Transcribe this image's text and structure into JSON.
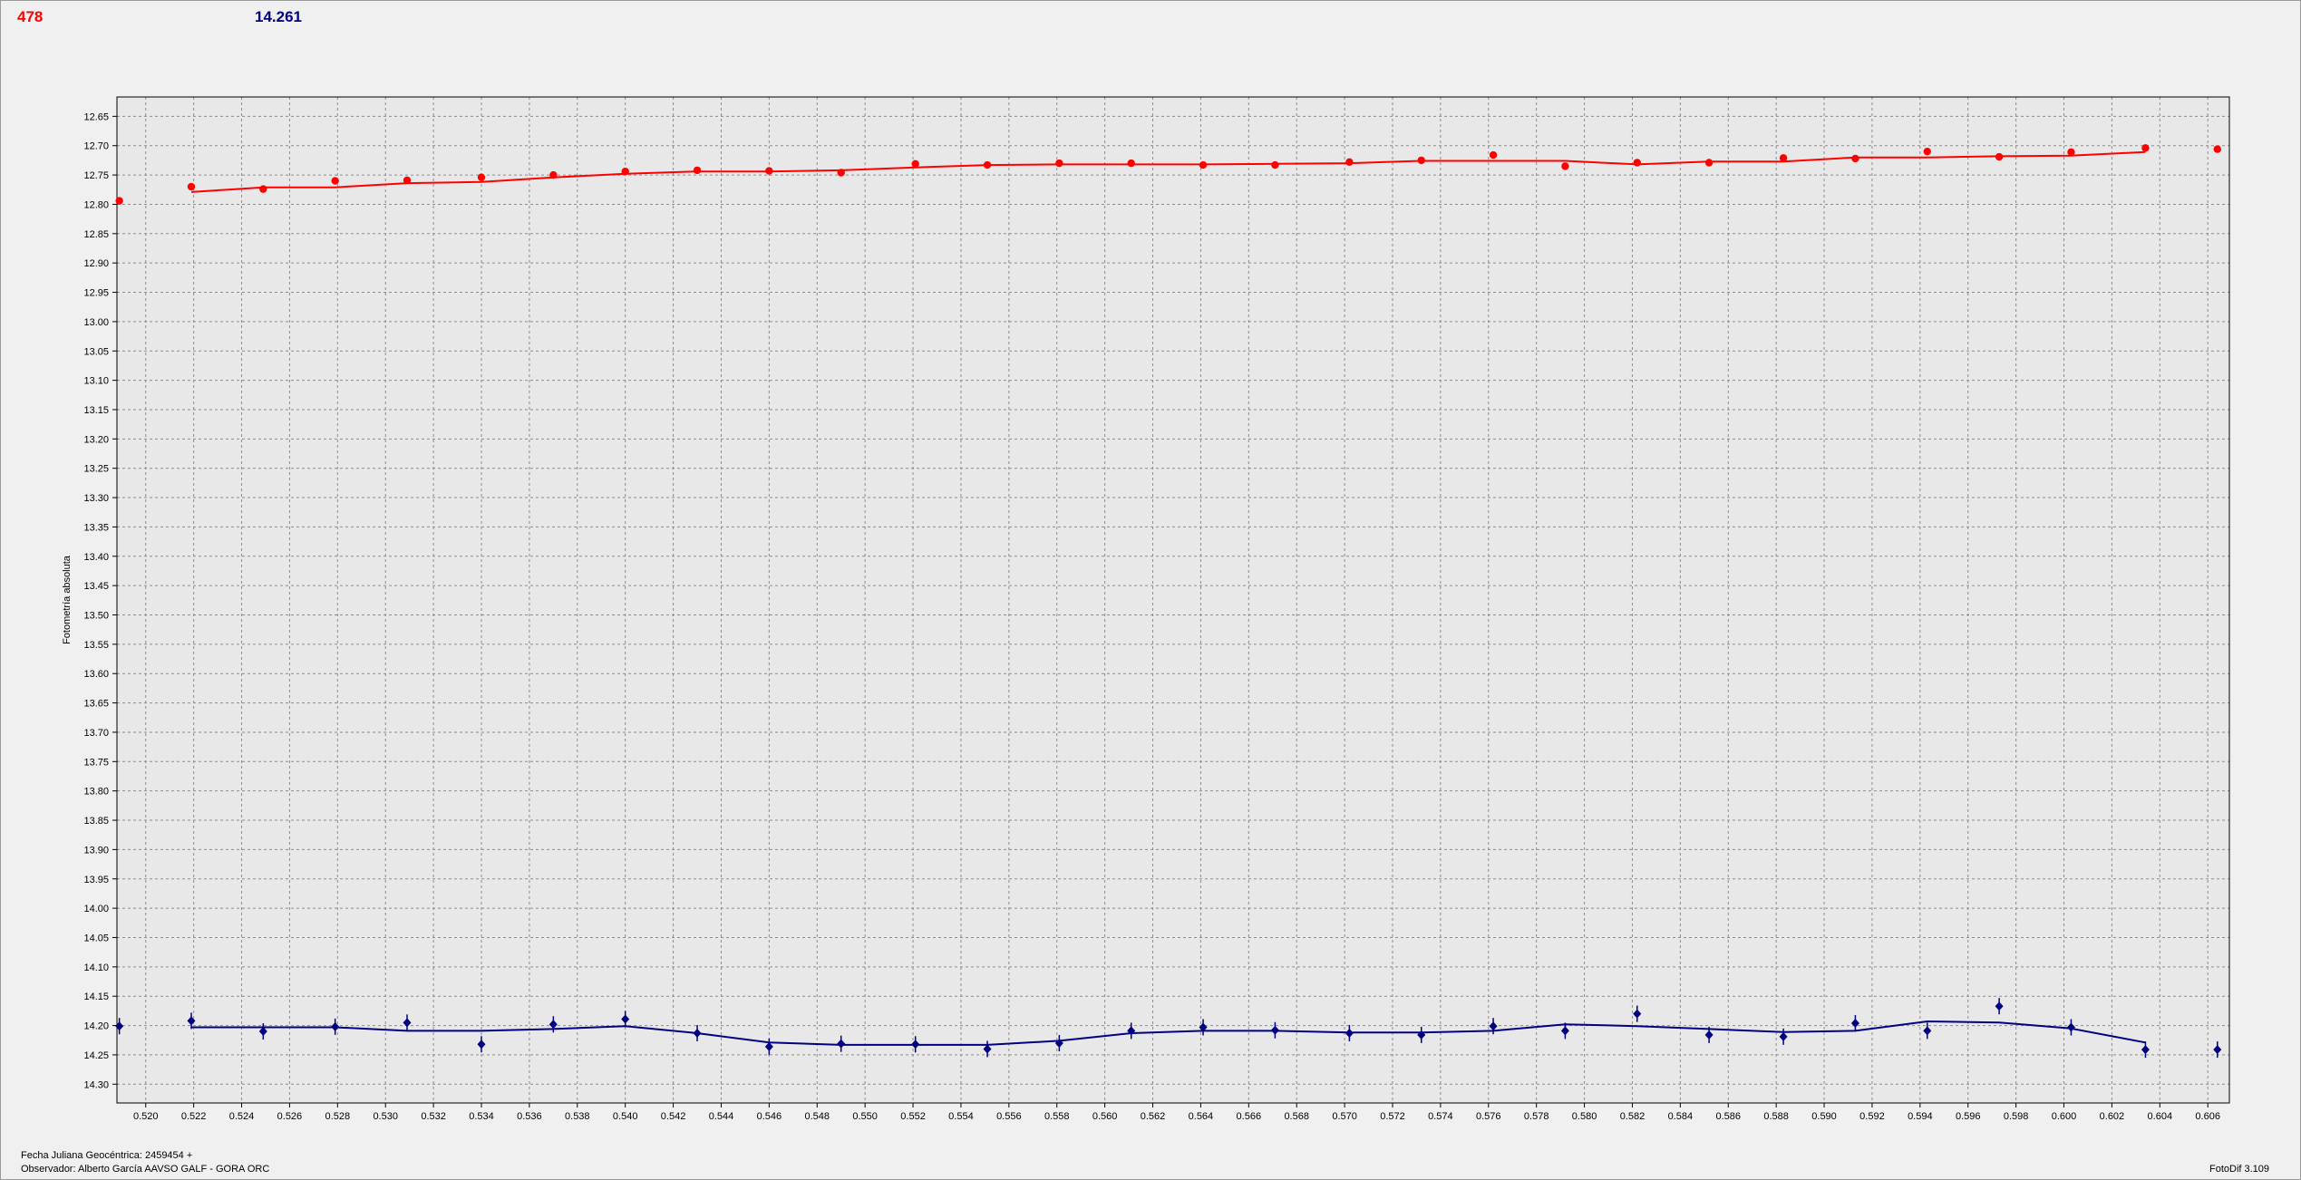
{
  "header": {
    "count": "478",
    "magnitude": "14.261"
  },
  "footer": {
    "date_line": "Fecha Juliana Geocéntrica: 2459454 +",
    "observer_line": "Observador: Alberto García AAVSO GALF - GORA ORC",
    "version": "FotoDif 3.109"
  },
  "colors": {
    "plot_background": "#e8e8e8",
    "grid": "#8c8c8c",
    "series_red": "#ff0000",
    "series_navy": "#000080"
  },
  "chart_data": {
    "type": "scatter",
    "title": "",
    "xlabel": "",
    "ylabel": "Fotometría absoluta",
    "xlim": [
      0.5188,
      0.6069
    ],
    "ylim": [
      12.617,
      14.332
    ],
    "y_inverted": true,
    "grid": true,
    "x_ticks": [
      "0.520",
      "0.522",
      "0.524",
      "0.526",
      "0.528",
      "0.530",
      "0.532",
      "0.534",
      "0.536",
      "0.538",
      "0.540",
      "0.542",
      "0.544",
      "0.546",
      "0.548",
      "0.550",
      "0.552",
      "0.554",
      "0.556",
      "0.558",
      "0.560",
      "0.562",
      "0.564",
      "0.566",
      "0.568",
      "0.570",
      "0.572",
      "0.574",
      "0.576",
      "0.578",
      "0.580",
      "0.582",
      "0.584",
      "0.586",
      "0.588",
      "0.590",
      "0.592",
      "0.594",
      "0.596",
      "0.598",
      "0.600",
      "0.602",
      "0.604",
      "0.606"
    ],
    "y_ticks": [
      "12.65",
      "12.70",
      "12.75",
      "12.80",
      "12.85",
      "12.90",
      "12.95",
      "13.00",
      "13.05",
      "13.10",
      "13.15",
      "13.20",
      "13.25",
      "13.30",
      "13.35",
      "13.40",
      "13.45",
      "13.50",
      "13.55",
      "13.60",
      "13.65",
      "13.70",
      "13.75",
      "13.80",
      "13.85",
      "13.90",
      "13.95",
      "14.00",
      "14.05",
      "14.10",
      "14.15",
      "14.20",
      "14.25",
      "14.30"
    ],
    "series": [
      {
        "color": "#ff0000",
        "marker": "dot",
        "points": [
          {
            "x": 0.5189,
            "y": 12.794
          },
          {
            "x": 0.5219,
            "y": 12.77
          },
          {
            "x": 0.5249,
            "y": 12.774
          },
          {
            "x": 0.5279,
            "y": 12.76
          },
          {
            "x": 0.5309,
            "y": 12.759
          },
          {
            "x": 0.534,
            "y": 12.754
          },
          {
            "x": 0.537,
            "y": 12.75
          },
          {
            "x": 0.54,
            "y": 12.744
          },
          {
            "x": 0.543,
            "y": 12.742
          },
          {
            "x": 0.546,
            "y": 12.743
          },
          {
            "x": 0.549,
            "y": 12.746
          },
          {
            "x": 0.5521,
            "y": 12.731
          },
          {
            "x": 0.5551,
            "y": 12.733
          },
          {
            "x": 0.5581,
            "y": 12.73
          },
          {
            "x": 0.5611,
            "y": 12.73
          },
          {
            "x": 0.5641,
            "y": 12.733
          },
          {
            "x": 0.5671,
            "y": 12.733
          },
          {
            "x": 0.5702,
            "y": 12.728
          },
          {
            "x": 0.5732,
            "y": 12.725
          },
          {
            "x": 0.5762,
            "y": 12.716
          },
          {
            "x": 0.5792,
            "y": 12.735
          },
          {
            "x": 0.5822,
            "y": 12.729
          },
          {
            "x": 0.5852,
            "y": 12.729
          },
          {
            "x": 0.5883,
            "y": 12.721
          },
          {
            "x": 0.5913,
            "y": 12.722
          },
          {
            "x": 0.5943,
            "y": 12.71
          },
          {
            "x": 0.5973,
            "y": 12.719
          },
          {
            "x": 0.6003,
            "y": 12.711
          },
          {
            "x": 0.6034,
            "y": 12.704
          },
          {
            "x": 0.6064,
            "y": 12.706
          }
        ],
        "trend": [
          {
            "x": 0.5219,
            "y": 12.779
          },
          {
            "x": 0.5249,
            "y": 12.771
          },
          {
            "x": 0.5279,
            "y": 12.771
          },
          {
            "x": 0.5309,
            "y": 12.764
          },
          {
            "x": 0.534,
            "y": 12.762
          },
          {
            "x": 0.537,
            "y": 12.754
          },
          {
            "x": 0.54,
            "y": 12.748
          },
          {
            "x": 0.543,
            "y": 12.744
          },
          {
            "x": 0.546,
            "y": 12.744
          },
          {
            "x": 0.549,
            "y": 12.742
          },
          {
            "x": 0.5521,
            "y": 12.737
          },
          {
            "x": 0.5551,
            "y": 12.733
          },
          {
            "x": 0.5581,
            "y": 12.732
          },
          {
            "x": 0.5611,
            "y": 12.732
          },
          {
            "x": 0.5641,
            "y": 12.732
          },
          {
            "x": 0.5671,
            "y": 12.731
          },
          {
            "x": 0.5702,
            "y": 12.73
          },
          {
            "x": 0.5732,
            "y": 12.726
          },
          {
            "x": 0.5762,
            "y": 12.726
          },
          {
            "x": 0.5792,
            "y": 12.726
          },
          {
            "x": 0.5822,
            "y": 12.732
          },
          {
            "x": 0.5852,
            "y": 12.727
          },
          {
            "x": 0.5883,
            "y": 12.727
          },
          {
            "x": 0.5913,
            "y": 12.72
          },
          {
            "x": 0.5943,
            "y": 12.72
          },
          {
            "x": 0.5973,
            "y": 12.718
          },
          {
            "x": 0.6003,
            "y": 12.717
          },
          {
            "x": 0.6034,
            "y": 12.711
          }
        ]
      },
      {
        "color": "#000080",
        "marker": "diamond-errorbar",
        "points": [
          {
            "x": 0.5189,
            "y": 14.201
          },
          {
            "x": 0.5219,
            "y": 14.192
          },
          {
            "x": 0.5249,
            "y": 14.21
          },
          {
            "x": 0.5279,
            "y": 14.202
          },
          {
            "x": 0.5309,
            "y": 14.195
          },
          {
            "x": 0.534,
            "y": 14.232
          },
          {
            "x": 0.537,
            "y": 14.198
          },
          {
            "x": 0.54,
            "y": 14.189
          },
          {
            "x": 0.543,
            "y": 14.213
          },
          {
            "x": 0.546,
            "y": 14.236
          },
          {
            "x": 0.549,
            "y": 14.231
          },
          {
            "x": 0.5521,
            "y": 14.232
          },
          {
            "x": 0.5551,
            "y": 14.24
          },
          {
            "x": 0.5581,
            "y": 14.23
          },
          {
            "x": 0.5611,
            "y": 14.209
          },
          {
            "x": 0.5641,
            "y": 14.203
          },
          {
            "x": 0.5671,
            "y": 14.208
          },
          {
            "x": 0.5702,
            "y": 14.213
          },
          {
            "x": 0.5732,
            "y": 14.216
          },
          {
            "x": 0.5762,
            "y": 14.201
          },
          {
            "x": 0.5792,
            "y": 14.209
          },
          {
            "x": 0.5822,
            "y": 14.18
          },
          {
            "x": 0.5852,
            "y": 14.216
          },
          {
            "x": 0.5883,
            "y": 14.219
          },
          {
            "x": 0.5913,
            "y": 14.196
          },
          {
            "x": 0.5943,
            "y": 14.209
          },
          {
            "x": 0.5973,
            "y": 14.167
          },
          {
            "x": 0.6003,
            "y": 14.203
          },
          {
            "x": 0.6034,
            "y": 14.241
          },
          {
            "x": 0.6064,
            "y": 14.241
          }
        ],
        "trend": [
          {
            "x": 0.5219,
            "y": 14.203
          },
          {
            "x": 0.5249,
            "y": 14.203
          },
          {
            "x": 0.5279,
            "y": 14.203
          },
          {
            "x": 0.5309,
            "y": 14.209
          },
          {
            "x": 0.534,
            "y": 14.209
          },
          {
            "x": 0.537,
            "y": 14.206
          },
          {
            "x": 0.54,
            "y": 14.201
          },
          {
            "x": 0.543,
            "y": 14.213
          },
          {
            "x": 0.546,
            "y": 14.229
          },
          {
            "x": 0.549,
            "y": 14.233
          },
          {
            "x": 0.5521,
            "y": 14.233
          },
          {
            "x": 0.5551,
            "y": 14.233
          },
          {
            "x": 0.5581,
            "y": 14.226
          },
          {
            "x": 0.5611,
            "y": 14.213
          },
          {
            "x": 0.5641,
            "y": 14.209
          },
          {
            "x": 0.5671,
            "y": 14.209
          },
          {
            "x": 0.5702,
            "y": 14.212
          },
          {
            "x": 0.5732,
            "y": 14.212
          },
          {
            "x": 0.5762,
            "y": 14.209
          },
          {
            "x": 0.5792,
            "y": 14.198
          },
          {
            "x": 0.5822,
            "y": 14.201
          },
          {
            "x": 0.5852,
            "y": 14.206
          },
          {
            "x": 0.5883,
            "y": 14.211
          },
          {
            "x": 0.5913,
            "y": 14.209
          },
          {
            "x": 0.5943,
            "y": 14.193
          },
          {
            "x": 0.5973,
            "y": 14.195
          },
          {
            "x": 0.6003,
            "y": 14.205
          },
          {
            "x": 0.6034,
            "y": 14.229
          }
        ]
      }
    ]
  }
}
